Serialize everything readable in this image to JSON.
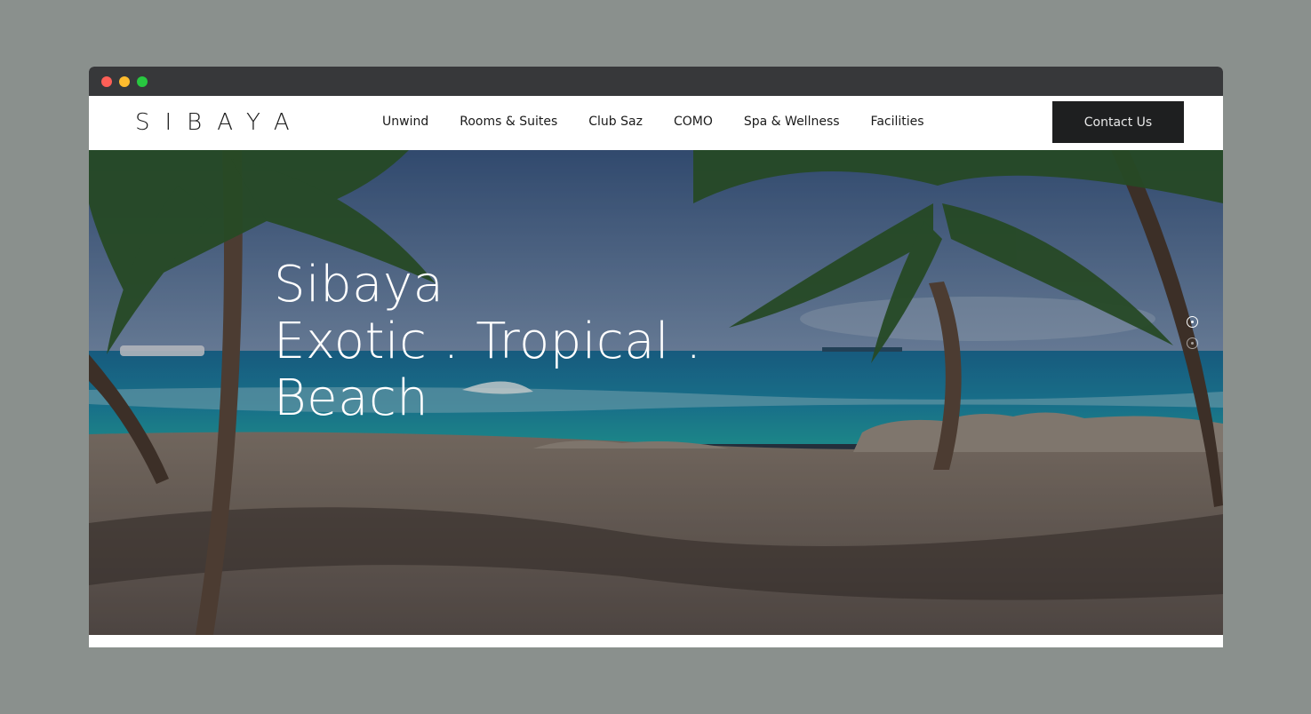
{
  "window": {
    "controls": [
      "close",
      "minimize",
      "maximize"
    ]
  },
  "brand": {
    "logo": "SIBAYA"
  },
  "nav": {
    "items": [
      {
        "label": "Unwind"
      },
      {
        "label": "Rooms & Suites"
      },
      {
        "label": "Club Saz"
      },
      {
        "label": "COMO"
      },
      {
        "label": "Spa & Wellness"
      },
      {
        "label": "Facilities"
      }
    ],
    "cta_label": "Contact Us"
  },
  "hero": {
    "lines": [
      "Sibaya",
      "Exotic . Tropical .",
      "Beach"
    ],
    "slides": {
      "count": 2,
      "active": 1
    }
  },
  "colors": {
    "page_bg": "#8a908d",
    "titlebar": "#37383a",
    "cta_bg": "#1e1f20",
    "sea": "#1f7fa0",
    "sand": "#6b5f58"
  }
}
